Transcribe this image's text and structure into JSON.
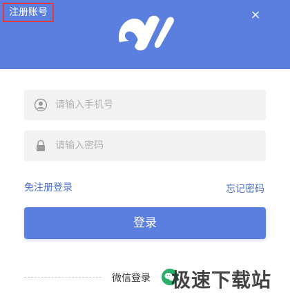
{
  "header": {
    "register_label": "注册账号",
    "close_glyph": "×",
    "logo_icon": "brand-logo-icon",
    "background": "#5b7fde"
  },
  "form": {
    "phone": {
      "placeholder": "请输入手机号",
      "icon": "user-icon"
    },
    "password": {
      "placeholder": "请输入密码",
      "icon": "lock-icon"
    },
    "sms_login_label": "免注册登录",
    "forgot_label": "忘记密码",
    "login_button_label": "登录",
    "accent": "#5b7fde"
  },
  "footer": {
    "wechat_label": "微信登录",
    "wechat_icon": "wechat-icon",
    "wechat_color": "#2aae67"
  },
  "watermark": "极速下载站"
}
